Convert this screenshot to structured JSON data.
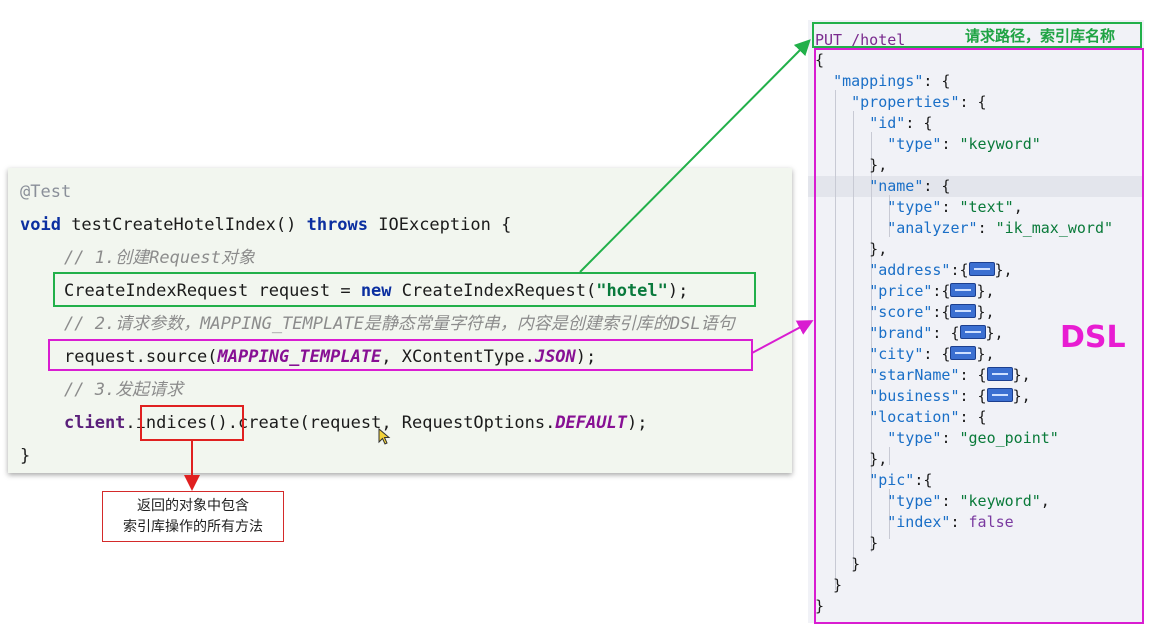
{
  "code": {
    "annotation": "@Test",
    "signature": {
      "void_kw": "void",
      "method": " testCreateHotelIndex() ",
      "throws_kw": "throws",
      "rest": " IOException {"
    },
    "comment1": "// 1.创建Request对象",
    "line_create": {
      "pre": "CreateIndexRequest request = ",
      "new_kw": "new",
      "mid": " CreateIndexRequest(",
      "str": "\"hotel\"",
      "post": ");"
    },
    "comment2": "// 2.请求参数，MAPPING_TEMPLATE是静态常量字符串，内容是创建索引库的DSL语句",
    "line_source": {
      "pre": "request.source(",
      "const1": "MAPPING_TEMPLATE",
      "mid": ", XContentType.",
      "const2": "JSON",
      "post": ");"
    },
    "comment3": "// 3.发起请求",
    "line_exec": {
      "client": "client",
      "dot": ".",
      "indices": "indices()",
      "create": ".create(request, RequestOptions.",
      "default": "DEFAULT",
      "post": ");"
    },
    "closing": "}"
  },
  "callout": {
    "line1": "返回的对象中包含",
    "line2": "索引库操作的所有方法"
  },
  "json": {
    "request_line": "PUT /hotel",
    "request_label": "请求路径，索引库名称",
    "dsl_label": "DSL",
    "lines": [
      {
        "pre": "{"
      },
      {
        "pre": "  ",
        "key": "\"mappings\"",
        "post": ": {"
      },
      {
        "pre": "    ",
        "key": "\"properties\"",
        "post": ": {"
      },
      {
        "pre": "      ",
        "key": "\"id\"",
        "post": ": {"
      },
      {
        "pre": "        ",
        "key": "\"type\"",
        "post": ": ",
        "val": "\"keyword\""
      },
      {
        "pre": "      },"
      },
      {
        "pre": "      ",
        "key": "\"name\"",
        "post": ": {"
      },
      {
        "pre": "        ",
        "key": "\"type\"",
        "post": ": ",
        "val": "\"text\"",
        "tail": ","
      },
      {
        "pre": "        ",
        "key": "\"analyzer\"",
        "post": ": ",
        "val": "\"ik_max_word\""
      },
      {
        "pre": "      },"
      },
      {
        "pre": "      ",
        "key": "\"address\"",
        "post": ":{",
        "fold": true,
        "tail": "},"
      },
      {
        "pre": "      ",
        "key": "\"price\"",
        "post": ":{",
        "fold": true,
        "tail": "},"
      },
      {
        "pre": "      ",
        "key": "\"score\"",
        "post": ":{",
        "fold": true,
        "tail": "},"
      },
      {
        "pre": "      ",
        "key": "\"brand\"",
        "post": ": {",
        "fold": true,
        "tail": "},"
      },
      {
        "pre": "      ",
        "key": "\"city\"",
        "post": ": {",
        "fold": true,
        "tail": "},"
      },
      {
        "pre": "      ",
        "key": "\"starName\"",
        "post": ": {",
        "fold": true,
        "tail": "},"
      },
      {
        "pre": "      ",
        "key": "\"business\"",
        "post": ": {",
        "fold": true,
        "tail": "},"
      },
      {
        "pre": "      ",
        "key": "\"location\"",
        "post": ": {"
      },
      {
        "pre": "        ",
        "key": "\"type\"",
        "post": ": ",
        "val": "\"geo_point\""
      },
      {
        "pre": "      },"
      },
      {
        "pre": "      ",
        "key": "\"pic\"",
        "post": ":{"
      },
      {
        "pre": "        ",
        "key": "\"type\"",
        "post": ": ",
        "val": "\"keyword\"",
        "tail": ","
      },
      {
        "pre": "        ",
        "key": "\"index\"",
        "post": ": ",
        "bool": "false"
      },
      {
        "pre": "      }"
      },
      {
        "pre": "    }"
      },
      {
        "pre": "  }"
      },
      {
        "pre": "}"
      }
    ]
  },
  "colors": {
    "request_box": "#22b04a",
    "dsl_box": "#d91dd1",
    "indices_box": "#e02020"
  }
}
